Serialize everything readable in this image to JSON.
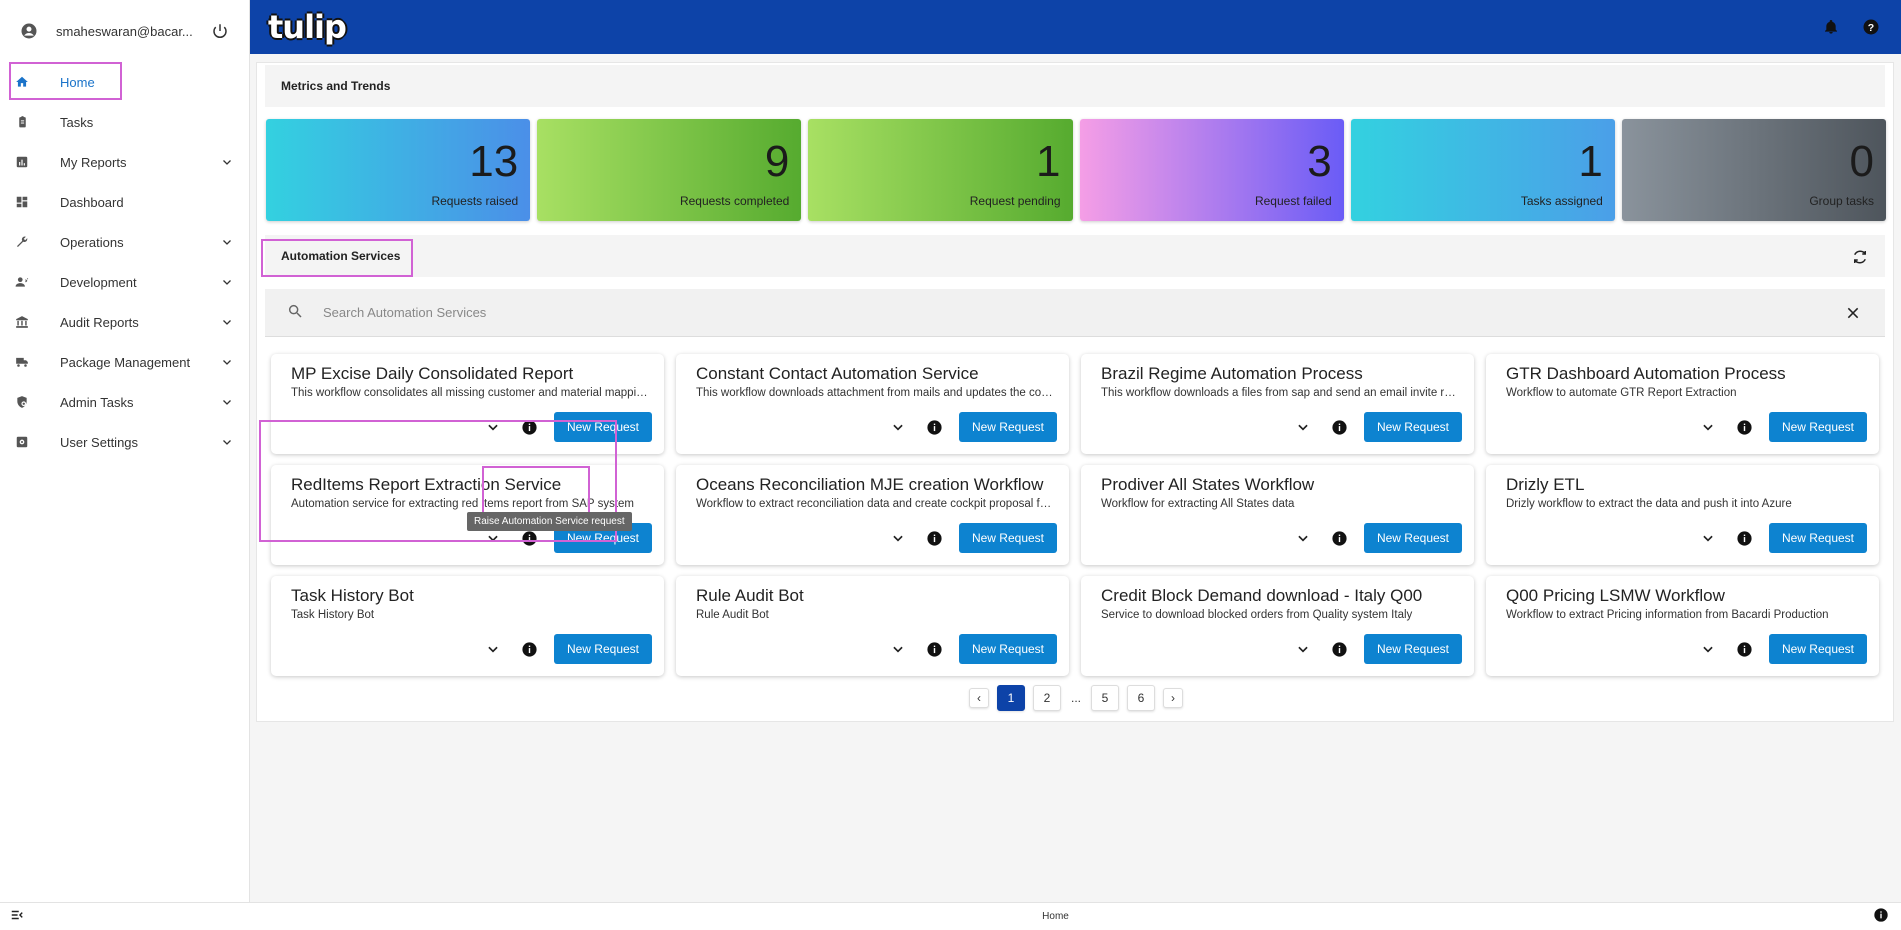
{
  "sidebar": {
    "user_email": "smaheswaran@bacar...",
    "items": [
      {
        "label": "Home",
        "icon": "home-icon",
        "expandable": false,
        "active": true
      },
      {
        "label": "Tasks",
        "icon": "clipboard-icon",
        "expandable": false
      },
      {
        "label": "My Reports",
        "icon": "report-icon",
        "expandable": true
      },
      {
        "label": "Dashboard",
        "icon": "dashboard-icon",
        "expandable": false
      },
      {
        "label": "Operations",
        "icon": "wrench-icon",
        "expandable": true
      },
      {
        "label": "Development",
        "icon": "developer-icon",
        "expandable": true
      },
      {
        "label": "Audit Reports",
        "icon": "bank-icon",
        "expandable": true
      },
      {
        "label": "Package Management",
        "icon": "truck-icon",
        "expandable": true
      },
      {
        "label": "Admin Tasks",
        "icon": "admin-gear-icon",
        "expandable": true
      },
      {
        "label": "User Settings",
        "icon": "settings-box-icon",
        "expandable": true
      }
    ]
  },
  "header": {
    "logo_text": "tulip",
    "brand_color": "#0d43a8"
  },
  "metrics_section": {
    "title": "Metrics and Trends",
    "cards": [
      {
        "value": "13",
        "label": "Requests raised",
        "gradient": [
          "#33d1e0",
          "#4b8fe8"
        ]
      },
      {
        "value": "9",
        "label": "Requests completed",
        "gradient": [
          "#a8e063",
          "#56ab2f"
        ]
      },
      {
        "value": "1",
        "label": "Request pending",
        "gradient": [
          "#a8e063",
          "#56ab2f"
        ]
      },
      {
        "value": "3",
        "label": "Request failed",
        "gradient": [
          "#f59ee6",
          "#6a5cf6"
        ]
      },
      {
        "value": "1",
        "label": "Tasks assigned",
        "gradient": [
          "#33d1e0",
          "#4b9fe8"
        ]
      },
      {
        "value": "0",
        "label": "Group tasks",
        "gradient": [
          "#8a939c",
          "#4e555c"
        ]
      }
    ]
  },
  "automation_section": {
    "title": "Automation Services",
    "search_placeholder": "Search Automation Services",
    "button_label": "New Request",
    "tooltip": "Raise Automation Service request",
    "services": [
      {
        "title": "MP Excise Daily Consolidated Report",
        "desc": "This workflow consolidates all missing customer and material mapping information"
      },
      {
        "title": "Constant Contact Automation Service",
        "desc": "This workflow downloads attachment from mails and updates the contacts list"
      },
      {
        "title": "Brazil Regime Automation Process",
        "desc": "This workflow downloads a files from sap and send an email invite regime"
      },
      {
        "title": "GTR Dashboard Automation Process",
        "desc": "Workflow to automate GTR Report Extraction"
      },
      {
        "title": "RedItems Report Extraction Service",
        "desc": "Automation service for extracting red items report from SAP system"
      },
      {
        "title": "Oceans Reconciliation MJE creation Workflow",
        "desc": "Workflow to extract reconciliation data and create cockpit proposal for MJE"
      },
      {
        "title": "Prodiver All States Workflow",
        "desc": "Workflow for extracting All States data"
      },
      {
        "title": "Drizly ETL",
        "desc": "Drizly workflow to extract the data and push it into Azure"
      },
      {
        "title": "Task History Bot",
        "desc": "Task History Bot"
      },
      {
        "title": "Rule Audit Bot",
        "desc": "Rule Audit Bot"
      },
      {
        "title": "Credit Block Demand download - Italy Q00",
        "desc": "Service to download blocked orders from Quality system Italy"
      },
      {
        "title": "Q00 Pricing LSMW Workflow",
        "desc": "Workflow to extract Pricing information from Bacardi Production"
      }
    ]
  },
  "pagination": {
    "prev": "‹",
    "pages": [
      "1",
      "2",
      "...",
      "5",
      "6"
    ],
    "next": "›",
    "current": "1"
  },
  "footer": {
    "label": "Home"
  }
}
